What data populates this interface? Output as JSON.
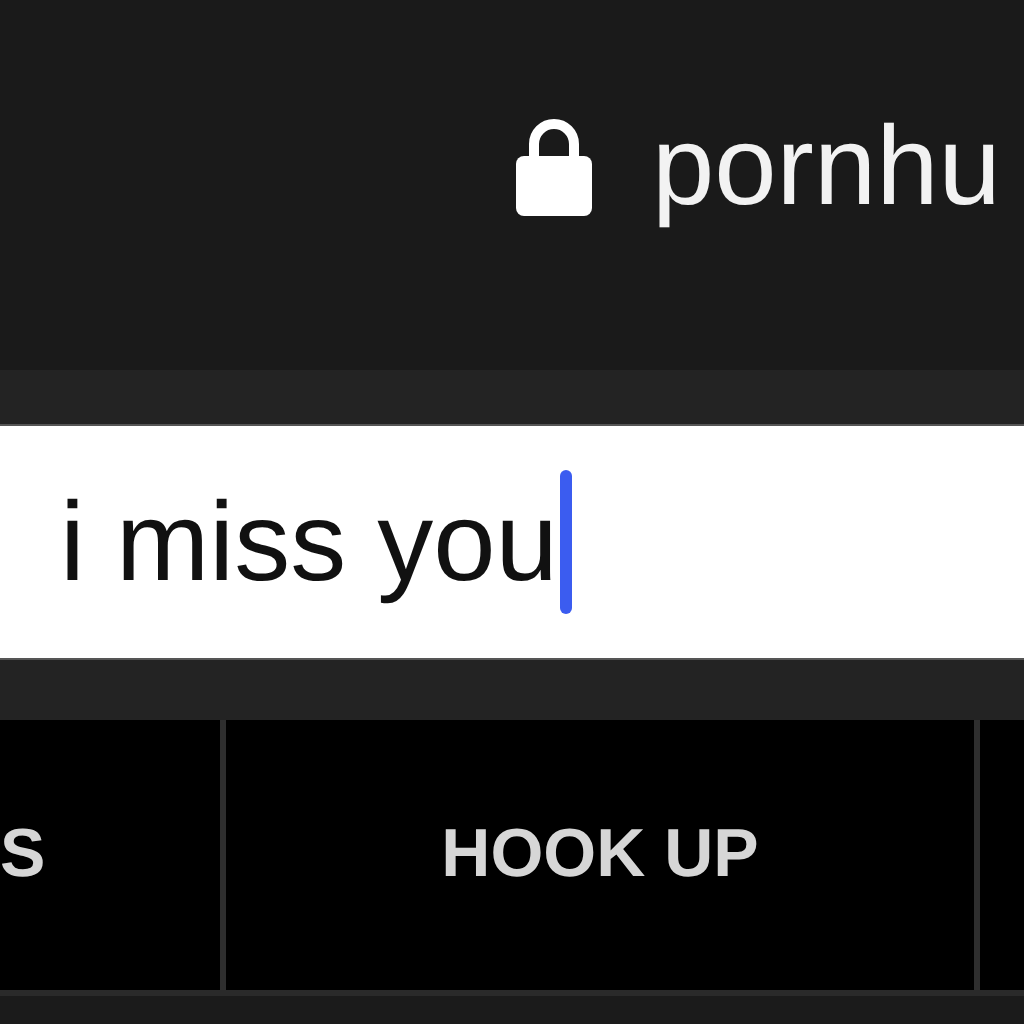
{
  "address_bar": {
    "url": "pornhu",
    "secure": true
  },
  "search": {
    "value": "i miss you",
    "focused": true
  },
  "nav_tabs": [
    {
      "label": "S",
      "selected": false
    },
    {
      "label": "HOOK UP",
      "selected": false
    }
  ]
}
